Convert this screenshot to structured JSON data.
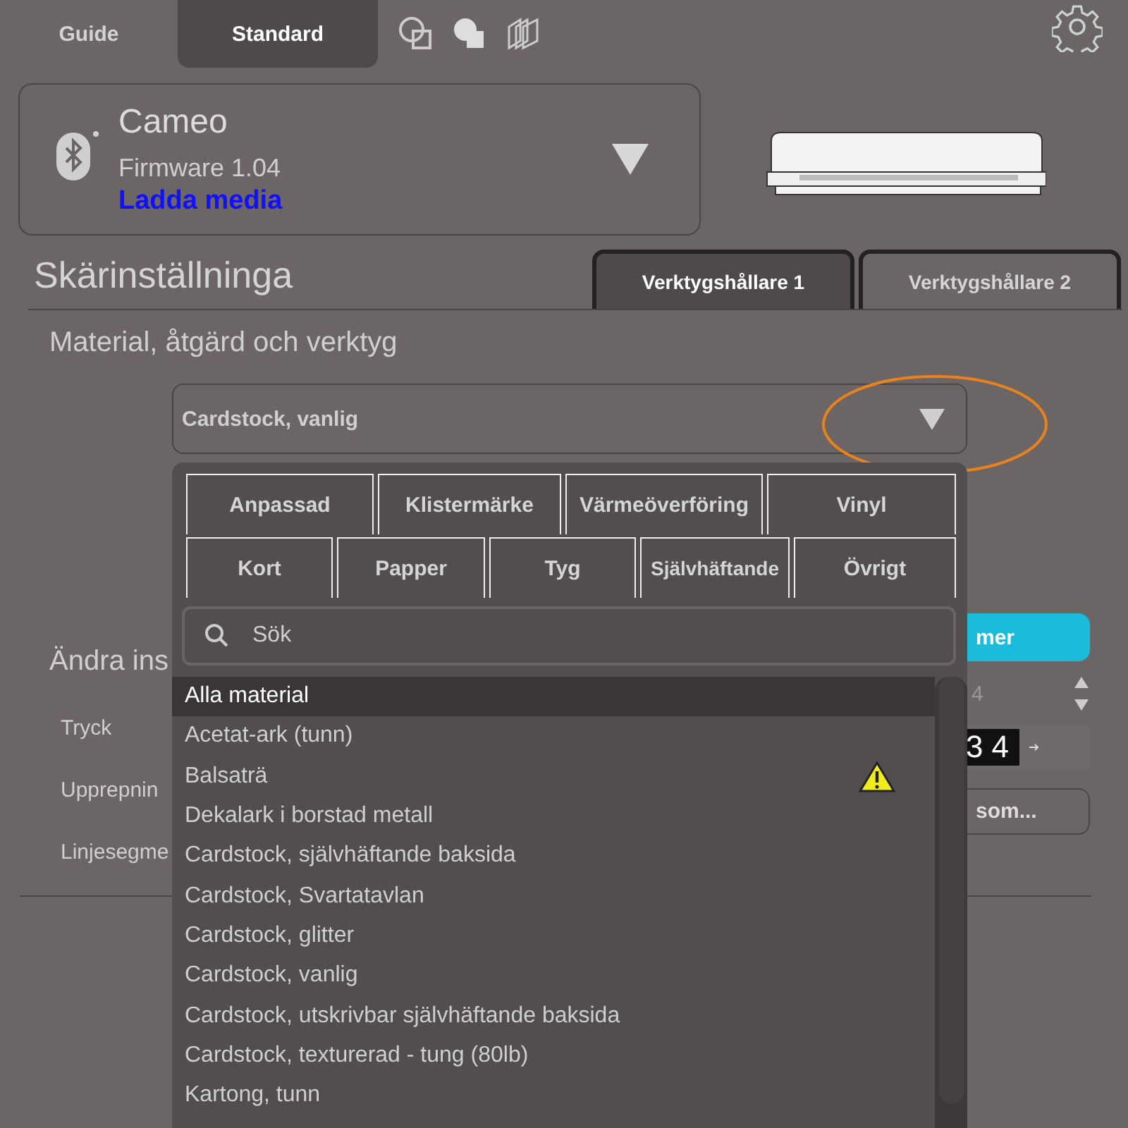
{
  "top_tabs": [
    {
      "label": "Guide",
      "selected": false
    },
    {
      "label": "Standard",
      "selected": true
    }
  ],
  "device": {
    "name": "Cameo",
    "firmware": "Firmware 1.04",
    "link": "Ladda media"
  },
  "section": {
    "title": "Skärinställninga",
    "tabs": [
      {
        "label": "Verktygshållare 1",
        "selected": true
      },
      {
        "label": "Verktygshållare 2",
        "selected": false
      }
    ]
  },
  "subtitle": "Material, åtgärd och verktyg",
  "material_select": {
    "value": "Cardstock, vanlig"
  },
  "settings": {
    "title": "Ändra ins",
    "labels": [
      "Tryck",
      "Upprepnin",
      "Linjesegme"
    ],
    "more_button": "mer",
    "pressure_value": "4",
    "counter": "34",
    "other_button": "som..."
  },
  "dropdown": {
    "categories": [
      [
        "Anpassad",
        "Klistermärke",
        "Värmeöverföring",
        "Vinyl"
      ],
      [
        "Kort",
        "Papper",
        "Tyg",
        "Självhäftande",
        "Övrigt"
      ]
    ],
    "search": {
      "placeholder": "Sök"
    },
    "materials": [
      {
        "label": "Alla material",
        "selected": true,
        "warning": false
      },
      {
        "label": "Acetat-ark (tunn)",
        "selected": false,
        "warning": false
      },
      {
        "label": "Balsaträ",
        "selected": false,
        "warning": true
      },
      {
        "label": "Dekalark i borstad metall",
        "selected": false,
        "warning": false
      },
      {
        "label": "Cardstock, självhäftande baksida",
        "selected": false,
        "warning": false
      },
      {
        "label": "Cardstock, Svartatavlan",
        "selected": false,
        "warning": false
      },
      {
        "label": "Cardstock, glitter",
        "selected": false,
        "warning": false
      },
      {
        "label": "Cardstock, vanlig",
        "selected": false,
        "warning": false
      },
      {
        "label": "Cardstock, utskrivbar självhäftande baksida",
        "selected": false,
        "warning": false
      },
      {
        "label": "Cardstock, texturerad - tung (80lb)",
        "selected": false,
        "warning": false
      },
      {
        "label": "Kartong, tunn",
        "selected": false,
        "warning": false
      }
    ]
  }
}
